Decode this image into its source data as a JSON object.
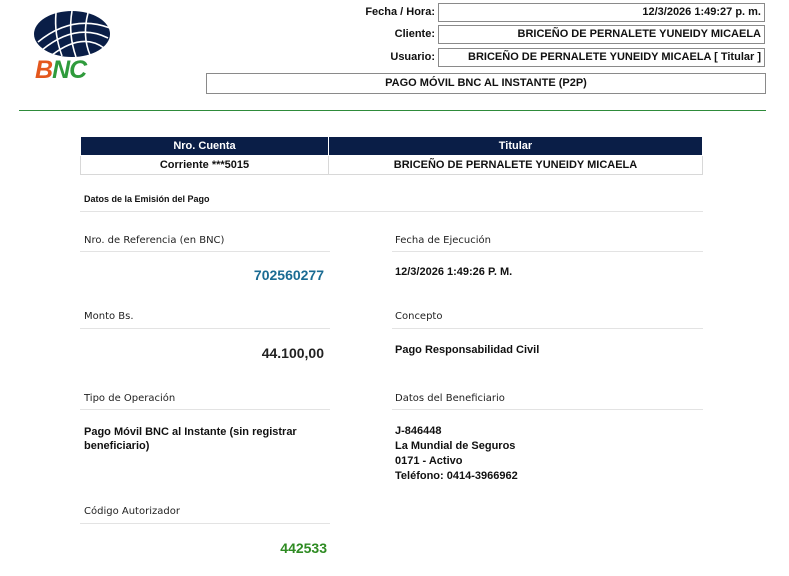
{
  "brand": {
    "logo_text_b": "B",
    "logo_text_nc": "NC",
    "colors": {
      "navy": "#0a1e47",
      "orange": "#e4571d",
      "green": "#2f9b3c",
      "link_blue": "#1a6b93",
      "auth_green": "#2e8b22"
    }
  },
  "header": {
    "fecha_label": "Fecha / Hora:",
    "fecha_value": "12/3/2026 1:49:27 p. m.",
    "cliente_label": "Cliente:",
    "cliente_value": "BRICEÑO DE PERNALETE YUNEIDY MICAELA",
    "usuario_label": "Usuario:",
    "usuario_value": "BRICEÑO DE PERNALETE YUNEIDY MICAELA [ Titular ]",
    "title": "PAGO MÓVIL BNC AL INSTANTE (P2P)"
  },
  "account_table": {
    "headers": [
      "Nro. Cuenta",
      "Titular"
    ],
    "row": [
      "Corriente ***5015",
      "BRICEÑO DE PERNALETE YUNEIDY MICAELA"
    ]
  },
  "section": {
    "title": "Datos de la Emisión del Pago"
  },
  "fields": {
    "referencia_label": "Nro. de Referencia (en BNC)",
    "referencia_value": "702560277",
    "fecha_ejec_label": "Fecha de Ejecución",
    "fecha_ejec_value": "12/3/2026 1:49:26 P. M.",
    "monto_label": "Monto Bs.",
    "monto_value": "44.100,00",
    "concepto_label": "Concepto",
    "concepto_value": "Pago Responsabilidad Civil",
    "tipo_label": "Tipo de Operación",
    "tipo_value_line1": "Pago Móvil BNC al Instante (sin registrar",
    "tipo_value_line2": "beneficiario)",
    "beneficiario_label": "Datos del Beneficiario",
    "beneficiario_lines": [
      "J-846448",
      "La Mundial de Seguros",
      "0171 - Activo",
      "Teléfono: 0414-3966962"
    ],
    "autorizador_label": "Código Autorizador",
    "autorizador_value": "442533"
  }
}
